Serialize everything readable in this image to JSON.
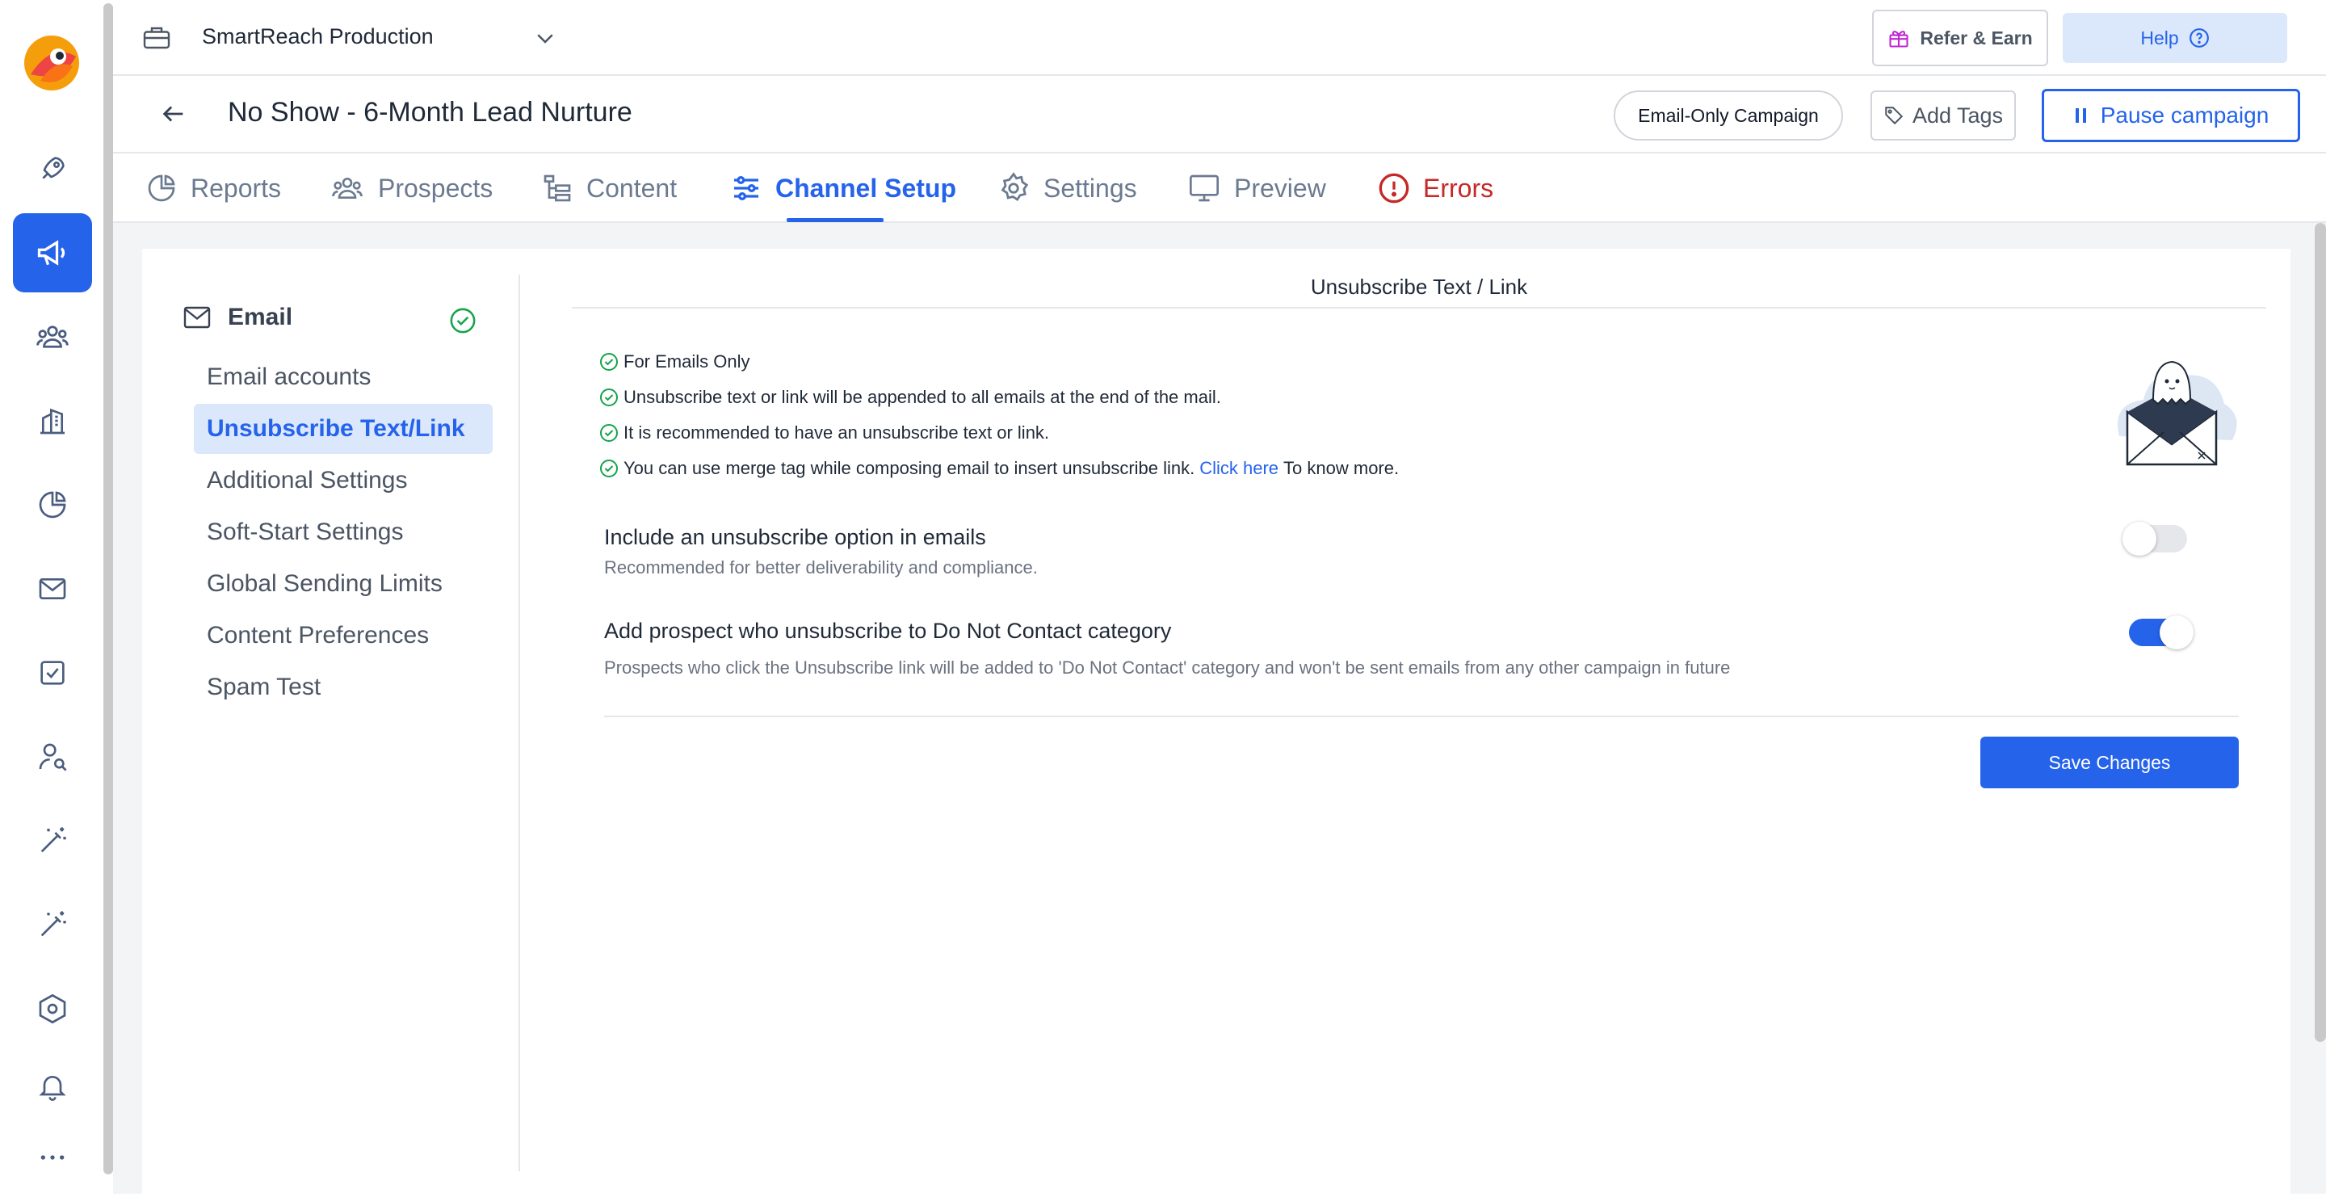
{
  "workspace": {
    "name": "SmartReach Production"
  },
  "top_actions": {
    "refer_label": "Refer & Earn",
    "help_label": "Help"
  },
  "campaign": {
    "title": "No Show - 6-Month Lead Nurture",
    "type_label": "Email-Only Campaign",
    "add_tags_label": "Add Tags",
    "pause_label": "Pause campaign"
  },
  "tabs": [
    {
      "label": "Reports",
      "icon": "pie-chart-icon"
    },
    {
      "label": "Prospects",
      "icon": "users-icon"
    },
    {
      "label": "Content",
      "icon": "content-tree-icon"
    },
    {
      "label": "Channel Setup",
      "icon": "sliders-icon",
      "active": true
    },
    {
      "label": "Settings",
      "icon": "gear-icon"
    },
    {
      "label": "Preview",
      "icon": "monitor-icon"
    },
    {
      "label": "Errors",
      "icon": "error-circle-icon"
    }
  ],
  "subnav": {
    "heading": "Email",
    "items": [
      "Email accounts",
      "Unsubscribe Text/Link",
      "Additional Settings",
      "Soft-Start Settings",
      "Global Sending Limits",
      "Content Preferences",
      "Spam Test"
    ],
    "active_index": 1
  },
  "section": {
    "title": "Unsubscribe Text / Link",
    "bullets": [
      "For Emails Only",
      "Unsubscribe text or link will be appended to all emails at the end of the mail.",
      "It is recommended to have an unsubscribe text or link."
    ],
    "merge_tag_text": "You can use merge tag while composing email to insert unsubscribe link.",
    "click_here": "Click here",
    "know_more": "To know more.",
    "option1": {
      "title": "Include an unsubscribe option in emails",
      "desc": "Recommended for better deliverability and compliance.",
      "enabled": false
    },
    "option2": {
      "title": "Add prospect who unsubscribe to Do Not Contact category",
      "desc": "Prospects who click the Unsubscribe link will be added to 'Do Not Contact' category and won't be sent emails from any other campaign in future",
      "enabled": true
    },
    "save_label": "Save Changes"
  },
  "colors": {
    "accent": "#2563eb",
    "error": "#c62828",
    "success": "#16a34a",
    "active_bg": "#dbe7fb"
  }
}
